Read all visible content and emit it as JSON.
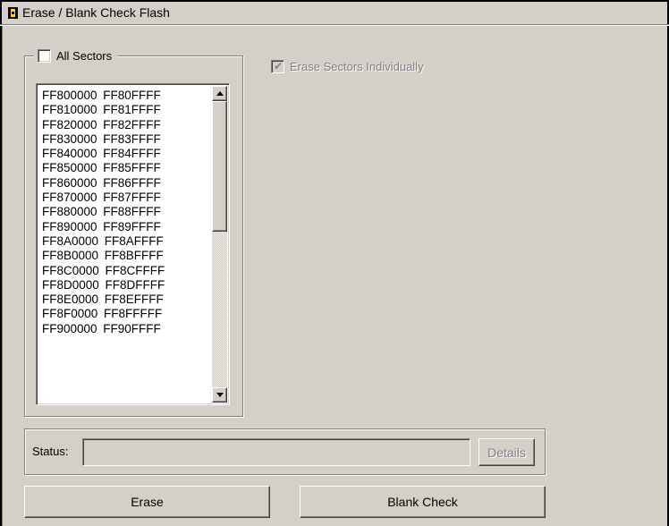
{
  "window": {
    "title": "Erase / Blank Check Flash",
    "icon": "app-icon"
  },
  "all_sectors": {
    "label": "All Sectors",
    "checked": false
  },
  "erase_individually": {
    "label": "Erase Sectors Individually",
    "checked": true,
    "enabled": false
  },
  "sectors": {
    "items": [
      "FF800000 FF80FFFF",
      "FF810000 FF81FFFF",
      "FF820000 FF82FFFF",
      "FF830000 FF83FFFF",
      "FF840000 FF84FFFF",
      "FF850000 FF85FFFF",
      "FF860000 FF86FFFF",
      "FF870000 FF87FFFF",
      "FF880000 FF88FFFF",
      "FF890000 FF89FFFF",
      "FF8A0000 FF8AFFFF",
      "FF8B0000 FF8BFFFF",
      "FF8C0000 FF8CFFFF",
      "FF8D0000 FF8DFFFF",
      "FF8E0000 FF8EFFFF",
      "FF8F0000 FF8FFFFF",
      "FF900000 FF90FFFF"
    ]
  },
  "status": {
    "label": "Status:",
    "value": "",
    "details_label": "Details"
  },
  "buttons": {
    "erase": "Erase",
    "blank_check": "Blank Check"
  },
  "colors": {
    "face": "#d4d0c8",
    "shadow": "#808080",
    "highlight": "#ffffff",
    "icon_accent": "#ffd200"
  }
}
